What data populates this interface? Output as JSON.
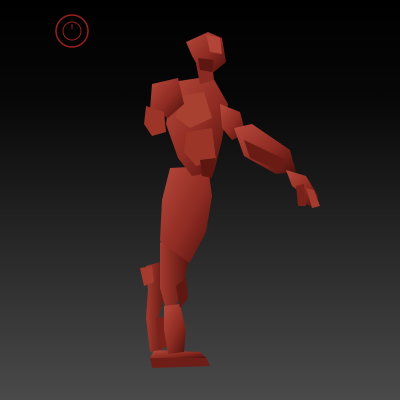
{
  "viewport": {
    "kind": "3d-sculpt-viewport",
    "background_top_color": "#000000",
    "background_bottom_color": "#4a4a4a"
  },
  "model": {
    "name": "humanoid-sculpt",
    "material_color": "#8e2b22",
    "highlight_color": "#b8493c",
    "shadow_color": "#4a100c"
  },
  "brush_cursor": {
    "icon": "brush-cursor-ring-icon",
    "color": "#9a1f1f"
  }
}
